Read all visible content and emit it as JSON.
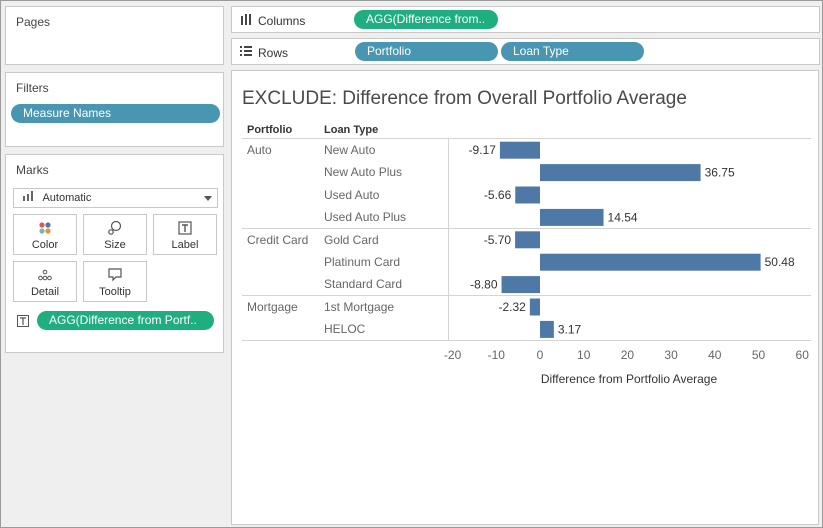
{
  "pages": {
    "title": "Pages"
  },
  "filters": {
    "title": "Filters",
    "pill": "Measure Names"
  },
  "marks": {
    "title": "Marks",
    "type": "Automatic",
    "buttons": {
      "color": "Color",
      "size": "Size",
      "label": "Label",
      "detail": "Detail",
      "tooltip": "Tooltip"
    },
    "label_pill": "AGG(Difference from Portf..",
    "colors": {
      "color_dots": [
        "#e15759",
        "#4e79a7",
        "#76b7b2",
        "#f28e2b"
      ]
    }
  },
  "shelves": {
    "columns_label": "Columns",
    "columns_pill": "AGG(Difference from..",
    "rows_label": "Rows",
    "rows_pills": [
      "Portfolio",
      "Loan Type"
    ]
  },
  "colors": {
    "bar": "#4e79a7",
    "pill_blue": "#4996b2",
    "pill_green": "#1fae80"
  },
  "viz": {
    "title": "EXCLUDE: Difference from Overall Portfolio Average",
    "row_headers": {
      "portfolio": "Portfolio",
      "loan_type": "Loan Type"
    },
    "groups": [
      "Auto",
      "Credit Card",
      "Mortgage"
    ]
  },
  "chart_data": {
    "type": "bar",
    "orientation": "horizontal",
    "title": "EXCLUDE: Difference from Overall Portfolio Average",
    "xlabel": "Difference from Portfolio Average",
    "ylabel": "",
    "xlim": [
      -20,
      60
    ],
    "xticks": [
      "-20",
      "-10",
      "0",
      "10",
      "20",
      "30",
      "40",
      "50",
      "60"
    ],
    "xtick_values": [
      -20,
      -10,
      0,
      10,
      20,
      30,
      40,
      50,
      60
    ],
    "grid": false,
    "rows": [
      {
        "portfolio": "Auto",
        "category": "New Auto",
        "value": -9.17,
        "label": "-9.17"
      },
      {
        "portfolio": "Auto",
        "category": "New Auto Plus",
        "value": 36.75,
        "label": "36.75"
      },
      {
        "portfolio": "Auto",
        "category": "Used Auto",
        "value": -5.66,
        "label": "-5.66"
      },
      {
        "portfolio": "Auto",
        "category": "Used Auto Plus",
        "value": 14.54,
        "label": "14.54"
      },
      {
        "portfolio": "Credit Card",
        "category": "Gold Card",
        "value": -5.7,
        "label": "-5.70"
      },
      {
        "portfolio": "Credit Card",
        "category": "Platinum Card",
        "value": 50.48,
        "label": "50.48"
      },
      {
        "portfolio": "Credit Card",
        "category": "Standard Card",
        "value": -8.8,
        "label": "-8.80"
      },
      {
        "portfolio": "Mortgage",
        "category": "1st Mortgage",
        "value": -2.32,
        "label": "-2.32"
      },
      {
        "portfolio": "Mortgage",
        "category": "HELOC",
        "value": 3.17,
        "label": "3.17"
      }
    ]
  }
}
